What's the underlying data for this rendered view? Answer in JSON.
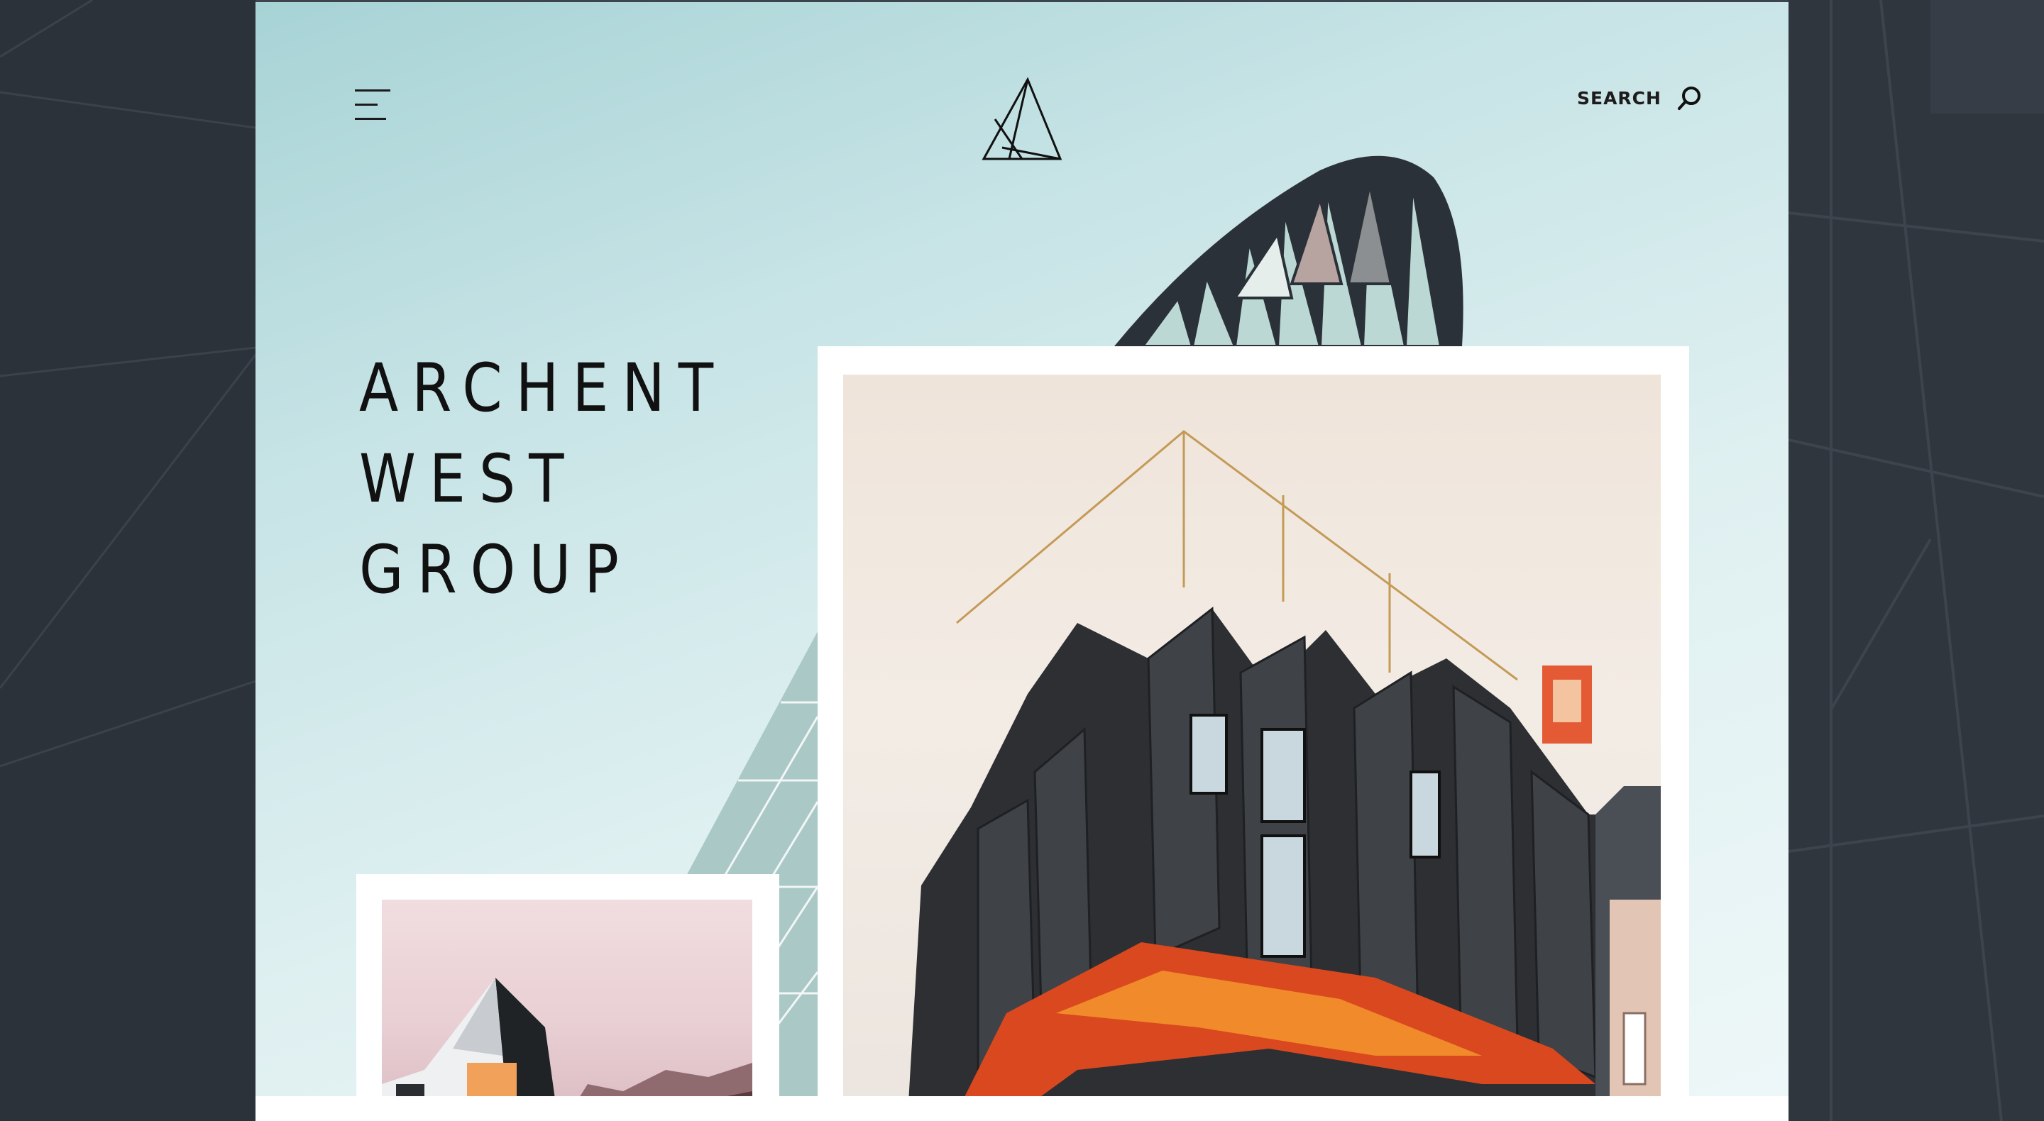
{
  "header": {
    "menu_icon": "hamburger-menu-icon",
    "logo_icon": "archent-logo-icon",
    "search_label": "SEARCH",
    "search_icon": "search-icon"
  },
  "hero": {
    "title_lines": [
      "ARCHENT",
      "WEST",
      "GROUP"
    ]
  },
  "images": {
    "main_photo": "modern-building-photo",
    "small_photo": "mountain-house-photo",
    "background": "glass-tower-architecture"
  },
  "colors": {
    "card_gradient_start": "#a7d3d6",
    "card_gradient_end": "#eef7f8",
    "side_dark": "#2c323a",
    "text": "#111111"
  }
}
